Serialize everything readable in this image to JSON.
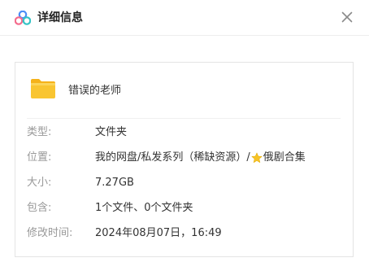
{
  "dialog": {
    "title": "详细信息",
    "close_icon": "close-icon",
    "logo_icon": "cloud-logo-icon"
  },
  "file": {
    "icon": "folder-icon",
    "name": "错误的老师"
  },
  "details": {
    "type_label": "类型:",
    "type_value": "文件夹",
    "location_label": "位置:",
    "location_value_before": "我的网盘/私发系列（稀缺资源）/",
    "location_star_icon": "star-icon",
    "location_value_after": "俄剧合集",
    "size_label": "大小:",
    "size_value": "7.27GB",
    "contains_label": "包含:",
    "contains_value": "1个文件、0个文件夹",
    "modified_label": "修改时间:",
    "modified_value": "2024年08月07日，16:49"
  },
  "colors": {
    "accent_blue": "#4a8cf7",
    "accent_pink": "#f46b8c",
    "accent_teal": "#34c3c5",
    "folder_yellow": "#f9c531",
    "folder_tab": "#f5b21a",
    "label_gray": "#999999",
    "text_dark": "#333333"
  }
}
